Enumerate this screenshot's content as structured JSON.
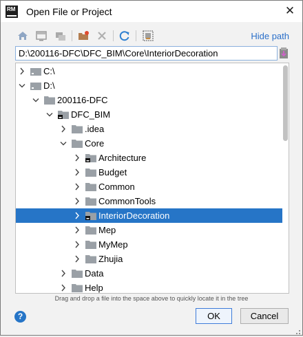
{
  "window": {
    "icon_text": "RM",
    "title": "Open File or Project",
    "close": "✕"
  },
  "toolbar": {
    "hide_path": "Hide path",
    "icons": [
      "home-icon",
      "desktop-icon",
      "project-icon",
      "new-folder-icon",
      "delete-icon",
      "refresh-icon",
      "show-hidden-icon"
    ]
  },
  "path": {
    "value": "D:\\200116-DFC\\DFC_BIM\\Core\\InteriorDecoration"
  },
  "tree": {
    "items": [
      {
        "label": "C:\\",
        "expanded": false,
        "kind": "drive"
      },
      {
        "label": "D:\\",
        "expanded": true,
        "kind": "drive"
      },
      {
        "label": "200116-DFC",
        "expanded": true,
        "kind": "folder"
      },
      {
        "label": "DFC_BIM",
        "expanded": true,
        "kind": "project"
      },
      {
        "label": ".idea",
        "expanded": false,
        "kind": "folder"
      },
      {
        "label": "Core",
        "expanded": true,
        "kind": "folder"
      },
      {
        "label": "Architecture",
        "expanded": false,
        "kind": "project"
      },
      {
        "label": "Budget",
        "expanded": false,
        "kind": "folder"
      },
      {
        "label": "Common",
        "expanded": false,
        "kind": "folder"
      },
      {
        "label": "CommonTools",
        "expanded": false,
        "kind": "folder"
      },
      {
        "label": "InteriorDecoration",
        "expanded": false,
        "kind": "project",
        "selected": true
      },
      {
        "label": "Mep",
        "expanded": false,
        "kind": "folder"
      },
      {
        "label": "MyMep",
        "expanded": false,
        "kind": "folder"
      },
      {
        "label": "Zhujia",
        "expanded": false,
        "kind": "folder"
      },
      {
        "label": "Data",
        "expanded": false,
        "kind": "folder"
      },
      {
        "label": "Help",
        "expanded": false,
        "kind": "folder"
      }
    ]
  },
  "hint": "Drag and drop a file into the space above to quickly locate it in the tree",
  "buttons": {
    "help": "?",
    "ok": "OK",
    "cancel": "Cancel"
  },
  "colors": {
    "selection": "#2675c7",
    "link": "#2a6fc9",
    "folder": "#9aa0a6"
  }
}
